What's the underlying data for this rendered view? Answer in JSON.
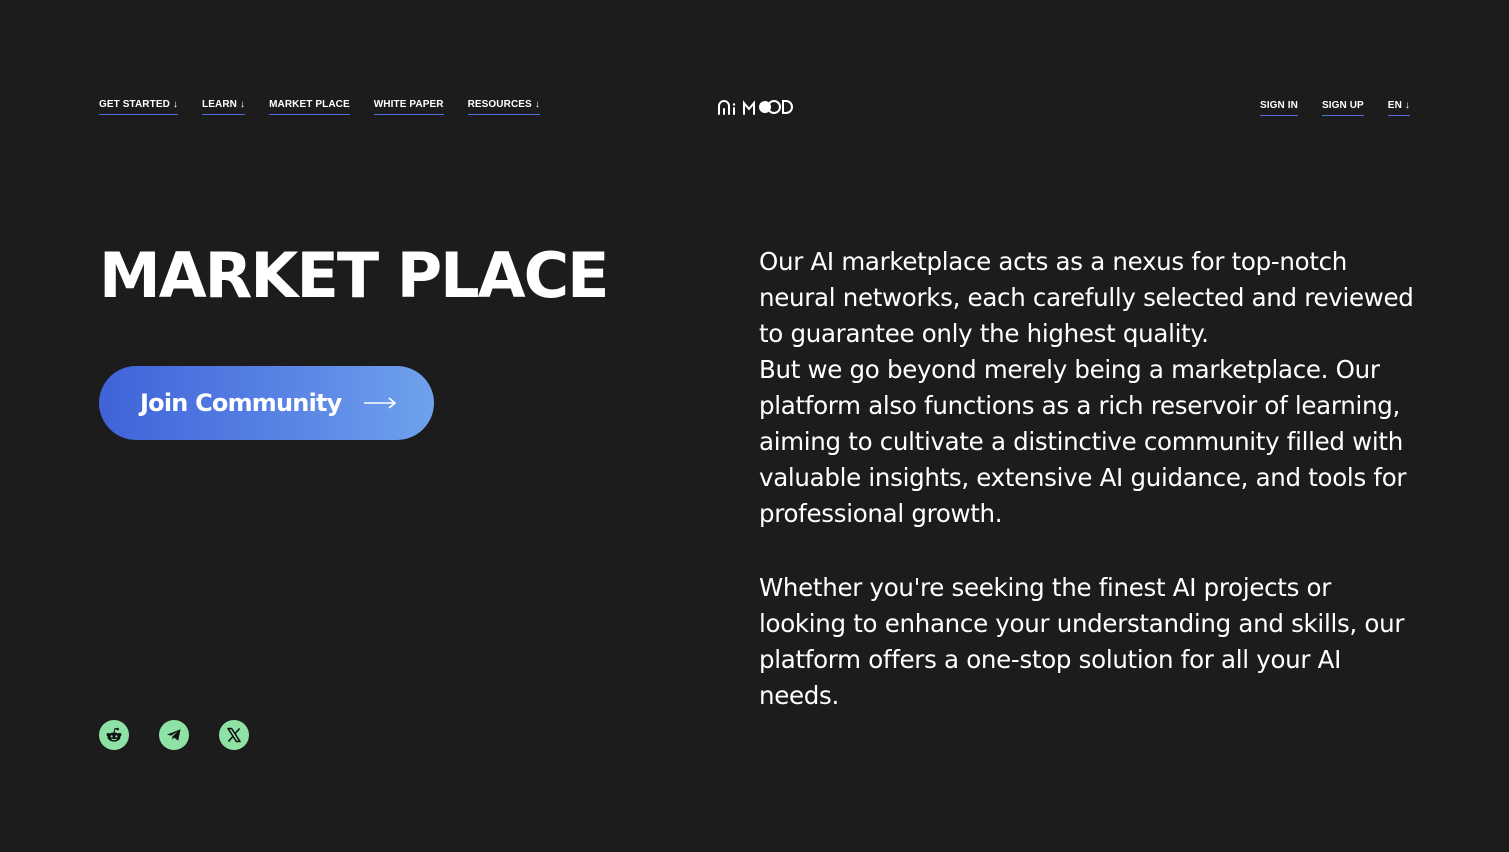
{
  "nav": {
    "left": [
      {
        "label": "GET STARTED",
        "dropdown": true
      },
      {
        "label": "LEARN",
        "dropdown": true
      },
      {
        "label": "MARKET PLACE",
        "dropdown": false
      },
      {
        "label": "WHITE PAPER",
        "dropdown": false
      },
      {
        "label": "RESOURCES",
        "dropdown": true
      }
    ],
    "right": {
      "sign_in": "SIGN IN",
      "sign_up": "SIGN UP",
      "language": "EN"
    },
    "dropdown_arrow": "↓"
  },
  "logo": {
    "icon": "aimood-logo"
  },
  "hero": {
    "title": "MARKET PLACE",
    "cta_label": "Join Community",
    "cta_icon": "arrow-right-icon",
    "paragraph_1": "Our AI marketplace acts as a nexus for top-notch neural networks, each carefully selected and reviewed to guarantee only the highest quality.",
    "paragraph_2": "But we go beyond merely being a marketplace. Our platform also functions as a rich reservoir of learning, aiming to cultivate a distinctive community filled with valuable insights, extensive AI guidance, and tools for professional growth.",
    "paragraph_3": "Whether you're seeking the finest AI projects or looking to enhance your understanding and skills, our platform offers a one-stop solution for all your AI needs."
  },
  "socials": [
    {
      "icon": "reddit-icon"
    },
    {
      "icon": "telegram-icon"
    },
    {
      "icon": "x-icon"
    }
  ],
  "colors": {
    "background": "#1c1c1c",
    "accent_underline": "#4f6fe0",
    "cta_gradient_start": "#3f63d8",
    "cta_gradient_end": "#6fa2ec",
    "social_bg": "#8ee2a5"
  }
}
